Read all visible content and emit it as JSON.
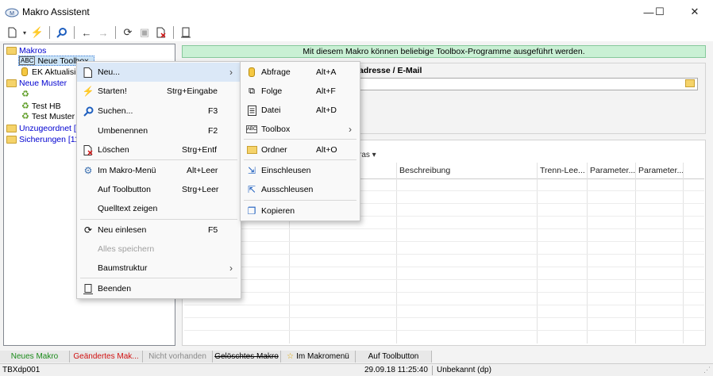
{
  "window": {
    "title": "Makro Assistent",
    "minimize": "—",
    "maximize": "☐",
    "close": "✕"
  },
  "tree": {
    "root": "Makros",
    "selected": "Neue Toolbox",
    "item2": "EK Aktualisie",
    "group2": "Neue Muster",
    "sub1": "Test HB",
    "sub2": "Test Muster",
    "group3": "Unzugeordnet [3]",
    "group4": "Sicherungen [11]"
  },
  "info_bar": "Mit diesem Makro können beliebige Toolbox-Programme ausgeführt werden.",
  "group1_label": "adresse / E-Mail",
  "group2_label": "ras",
  "grid_headers": [
    "Beschreibung",
    "Trenn-Lee...",
    "Parameter...",
    "Parameter..."
  ],
  "context_menu": [
    {
      "label": "Neu...",
      "shortcut": "",
      "icon": "new-icon"
    },
    {
      "label": "Starten!",
      "shortcut": "Strg+Eingabe",
      "icon": "flash-icon"
    },
    {
      "label": "Suchen...",
      "shortcut": "F3",
      "icon": "search-icon"
    },
    {
      "label": "Umbenennen",
      "shortcut": "F2",
      "icon": ""
    },
    {
      "label": "Löschen",
      "shortcut": "Strg+Entf",
      "icon": "delete-icon"
    },
    {
      "label": "Im Makro-Menü",
      "shortcut": "Alt+Leer",
      "icon": "settings-icon"
    },
    {
      "label": "Auf Toolbutton",
      "shortcut": "Strg+Leer",
      "icon": ""
    },
    {
      "label": "Quelltext zeigen",
      "shortcut": "",
      "icon": ""
    },
    {
      "label": "Neu einlesen",
      "shortcut": "F5",
      "icon": "refresh-icon"
    },
    {
      "label": "Alles speichern",
      "shortcut": "",
      "icon": ""
    },
    {
      "label": "Baumstruktur",
      "shortcut": "",
      "icon": ""
    },
    {
      "label": "Beenden",
      "shortcut": "",
      "icon": "exit-icon"
    }
  ],
  "submenu": [
    {
      "label": "Abfrage",
      "shortcut": "Alt+A",
      "icon": "query-icon"
    },
    {
      "label": "Folge",
      "shortcut": "Alt+F",
      "icon": "sequence-icon"
    },
    {
      "label": "Datei",
      "shortcut": "Alt+D",
      "icon": "file-icon"
    },
    {
      "label": "Toolbox",
      "shortcut": "",
      "icon": "toolbox-icon"
    },
    {
      "label": "Ordner",
      "shortcut": "Alt+O",
      "icon": "folder-icon"
    },
    {
      "label": "Einschleusen",
      "shortcut": "",
      "icon": "import-icon"
    },
    {
      "label": "Ausschleusen",
      "shortcut": "",
      "icon": "export-icon"
    },
    {
      "label": "Kopieren",
      "shortcut": "",
      "icon": "copy-icon"
    }
  ],
  "legend_tabs": [
    "Neues Makro",
    "Geändertes Mak...",
    "Nicht vorhanden",
    "Gelöschtes Makro",
    "Im Makromenü",
    "Auf Toolbutton"
  ],
  "status": {
    "left": "TBXdp001",
    "datetime": "29.09.18 11:25:40",
    "user": "Unbekannt (dp)"
  },
  "colors": {
    "info_bg": "#c9f0d4",
    "new_green": "#1a8a1a",
    "changed_red": "#d01010",
    "tree_blue": "#0000d0"
  }
}
